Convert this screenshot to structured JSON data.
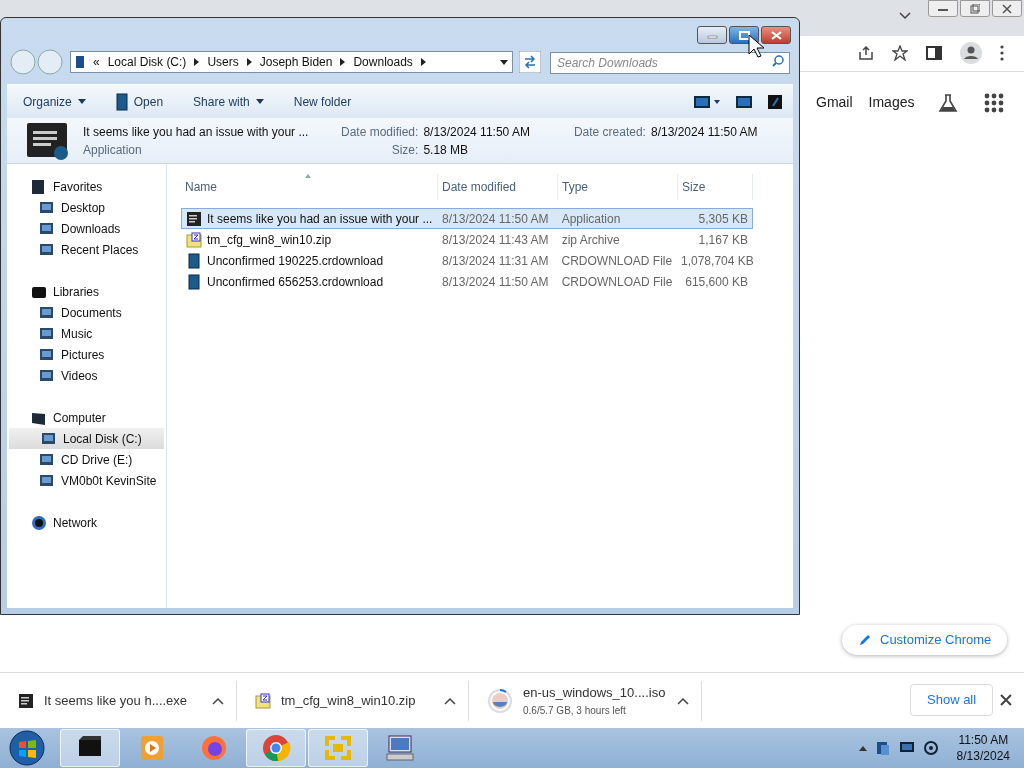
{
  "chrome": {
    "links": [
      "Gmail",
      "Images"
    ],
    "customize_button": "Customize Chrome"
  },
  "explorer": {
    "breadcrumb_overflow": "«",
    "breadcrumb": [
      "Local Disk (C:)",
      "Users",
      "Joseph Biden",
      "Downloads"
    ],
    "search": {
      "placeholder": "Search Downloads"
    },
    "toolbar": [
      {
        "label": "Organize",
        "dropdown": true,
        "icon": false
      },
      {
        "label": "Open",
        "dropdown": false,
        "icon": true
      },
      {
        "label": "Share with",
        "dropdown": true,
        "icon": false
      },
      {
        "label": "New folder",
        "dropdown": false,
        "icon": false
      }
    ],
    "details": {
      "name": "It seems like you had an issue with your ...",
      "type": "Application",
      "fields": [
        {
          "label": "Date modified:",
          "value": "8/13/2024 11:50 AM"
        },
        {
          "label": "Date created:",
          "value": "8/13/2024 11:50 AM"
        },
        {
          "label": "Size:",
          "value": "5.18 MB"
        }
      ]
    },
    "sidebar": [
      {
        "label": "Favorites",
        "items": [
          {
            "label": "Desktop",
            "selected": false
          },
          {
            "label": "Downloads",
            "selected": false
          },
          {
            "label": "Recent Places",
            "selected": false
          }
        ]
      },
      {
        "label": "Libraries",
        "items": [
          {
            "label": "Documents",
            "selected": false
          },
          {
            "label": "Music",
            "selected": false
          },
          {
            "label": "Pictures",
            "selected": false
          },
          {
            "label": "Videos",
            "selected": false
          }
        ]
      },
      {
        "label": "Computer",
        "items": [
          {
            "label": "Local Disk (C:)",
            "selected": true
          },
          {
            "label": "CD Drive (E:)",
            "selected": false
          },
          {
            "label": "VM0b0t KevinSite",
            "selected": false
          }
        ]
      },
      {
        "label": "Network"
      }
    ],
    "columns": [
      "Name",
      "Date modified",
      "Type",
      "Size"
    ],
    "rows": [
      {
        "kind": "app",
        "name": "It seems like you had an issue with your ...",
        "date": "8/13/2024 11:50 AM",
        "type": "Application",
        "size": "5,305 KB",
        "selected": true
      },
      {
        "kind": "zip",
        "name": "tm_cfg_win8_win10.zip",
        "date": "8/13/2024 11:43 AM",
        "type": "zip Archive",
        "size": "1,167 KB",
        "selected": false
      },
      {
        "kind": "file",
        "name": "Unconfirmed 190225.crdownload",
        "date": "8/13/2024 11:31 AM",
        "type": "CRDOWNLOAD File",
        "size": "1,078,704 KB",
        "selected": false
      },
      {
        "kind": "file",
        "name": "Unconfirmed 656253.crdownload",
        "date": "8/13/2024 11:50 AM",
        "type": "CRDOWNLOAD File",
        "size": "615,600 KB",
        "selected": false
      }
    ]
  },
  "downloads": [
    {
      "kind": "app",
      "name": "It seems like you h....exe"
    },
    {
      "kind": "zip",
      "name": "tm_cfg_win8_win10.zip"
    },
    {
      "kind": "progress",
      "name": "en-us_windows_10....iso",
      "status": "0.6/5.7 GB, 3 hours left"
    }
  ],
  "show_all": "Show all",
  "taskbar": {
    "apps": [
      {
        "kind": "explorer",
        "active": true
      },
      {
        "kind": "media",
        "active": false
      },
      {
        "kind": "firefox",
        "active": false
      },
      {
        "kind": "chrome",
        "active": true
      },
      {
        "kind": "frame",
        "active": true
      },
      {
        "kind": "terminal",
        "active": false
      }
    ],
    "time": "11:50 AM",
    "date": "8/13/2024"
  }
}
